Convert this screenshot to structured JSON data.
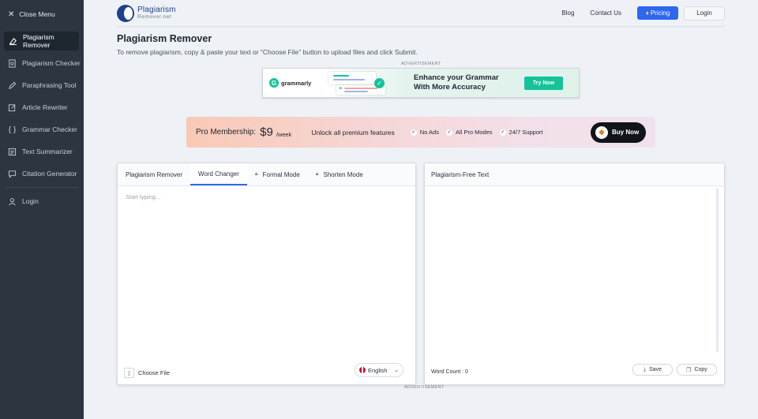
{
  "sidebar": {
    "close_label": "Close Menu",
    "items": [
      {
        "label": "Plagiarism Remover",
        "icon": "eraser-icon",
        "active": true
      },
      {
        "label": "Plagiarism Checker",
        "icon": "document-search-icon"
      },
      {
        "label": "Paraphrasing Tool",
        "icon": "pen-icon"
      },
      {
        "label": "Article Rewriter",
        "icon": "edit-icon"
      },
      {
        "label": "Grammar Checker",
        "icon": "braces-icon"
      },
      {
        "label": "Text Summarizer",
        "icon": "list-icon"
      },
      {
        "label": "Citation Generator",
        "icon": "quote-icon"
      }
    ],
    "login_label": "Login"
  },
  "header": {
    "logo_name": "Plagiarism",
    "logo_sub": "Remover.net",
    "nav": {
      "blog": "Blog",
      "contact": "Contact Us",
      "pricing": "Pricing",
      "login": "Login"
    }
  },
  "page": {
    "title": "Plagiarism Remover",
    "subtitle": "To remove plagiarism, copy & paste your text or \"Choose File\" button to upload files and click Submit.",
    "ad_label_top": "ADVERTISEMENT",
    "ad_label_bottom": "ADVERTISEMENT"
  },
  "ad": {
    "brand": "grammarly",
    "headline_1": "Enhance your Grammar",
    "headline_2": "With More Accuracy",
    "cta": "Try Now"
  },
  "pro": {
    "label": "Pro Membership:",
    "price": "$9",
    "period": "/week",
    "unlock": "Unlock all premium features",
    "features": [
      "No Ads",
      "All Pro Modes",
      "24/7 Support"
    ],
    "buy": "Buy Now"
  },
  "left_panel": {
    "tabs": [
      "Plagiarism Remover",
      "Word Changer",
      "Formal Mode",
      "Shorten Mode"
    ],
    "placeholder": "Start typing...",
    "choose_file": "Choose File",
    "language": "English"
  },
  "right_panel": {
    "title": "Plagiarism-Free Text",
    "word_count": "Word Count : 0",
    "save": "Save",
    "copy": "Copy"
  },
  "colors": {
    "accent": "#2f67f0",
    "sidebar_bg": "#2c3540",
    "grammarly_green": "#15c39a"
  }
}
